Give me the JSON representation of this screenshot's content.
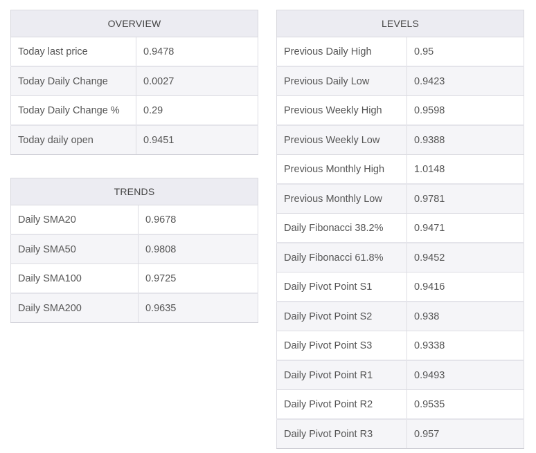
{
  "overview": {
    "title": "OVERVIEW",
    "rows": [
      {
        "label": "Today last price",
        "value": "0.9478"
      },
      {
        "label": "Today Daily Change",
        "value": "0.0027"
      },
      {
        "label": "Today Daily Change %",
        "value": "0.29"
      },
      {
        "label": "Today daily open",
        "value": "0.9451"
      }
    ]
  },
  "trends": {
    "title": "TRENDS",
    "rows": [
      {
        "label": "Daily SMA20",
        "value": "0.9678"
      },
      {
        "label": "Daily SMA50",
        "value": "0.9808"
      },
      {
        "label": "Daily SMA100",
        "value": "0.9725"
      },
      {
        "label": "Daily SMA200",
        "value": "0.9635"
      }
    ]
  },
  "levels": {
    "title": "LEVELS",
    "rows": [
      {
        "label": "Previous Daily High",
        "value": "0.95"
      },
      {
        "label": "Previous Daily Low",
        "value": "0.9423"
      },
      {
        "label": "Previous Weekly High",
        "value": "0.9598"
      },
      {
        "label": "Previous Weekly Low",
        "value": "0.9388"
      },
      {
        "label": "Previous Monthly High",
        "value": "1.0148"
      },
      {
        "label": "Previous Monthly Low",
        "value": "0.9781"
      },
      {
        "label": "Daily Fibonacci 38.2%",
        "value": "0.9471"
      },
      {
        "label": "Daily Fibonacci 61.8%",
        "value": "0.9452"
      },
      {
        "label": "Daily Pivot Point S1",
        "value": "0.9416"
      },
      {
        "label": "Daily Pivot Point S2",
        "value": "0.938"
      },
      {
        "label": "Daily Pivot Point S3",
        "value": "0.9338"
      },
      {
        "label": "Daily Pivot Point R1",
        "value": "0.9493"
      },
      {
        "label": "Daily Pivot Point R2",
        "value": "0.9535"
      },
      {
        "label": "Daily Pivot Point R3",
        "value": "0.957"
      }
    ]
  }
}
